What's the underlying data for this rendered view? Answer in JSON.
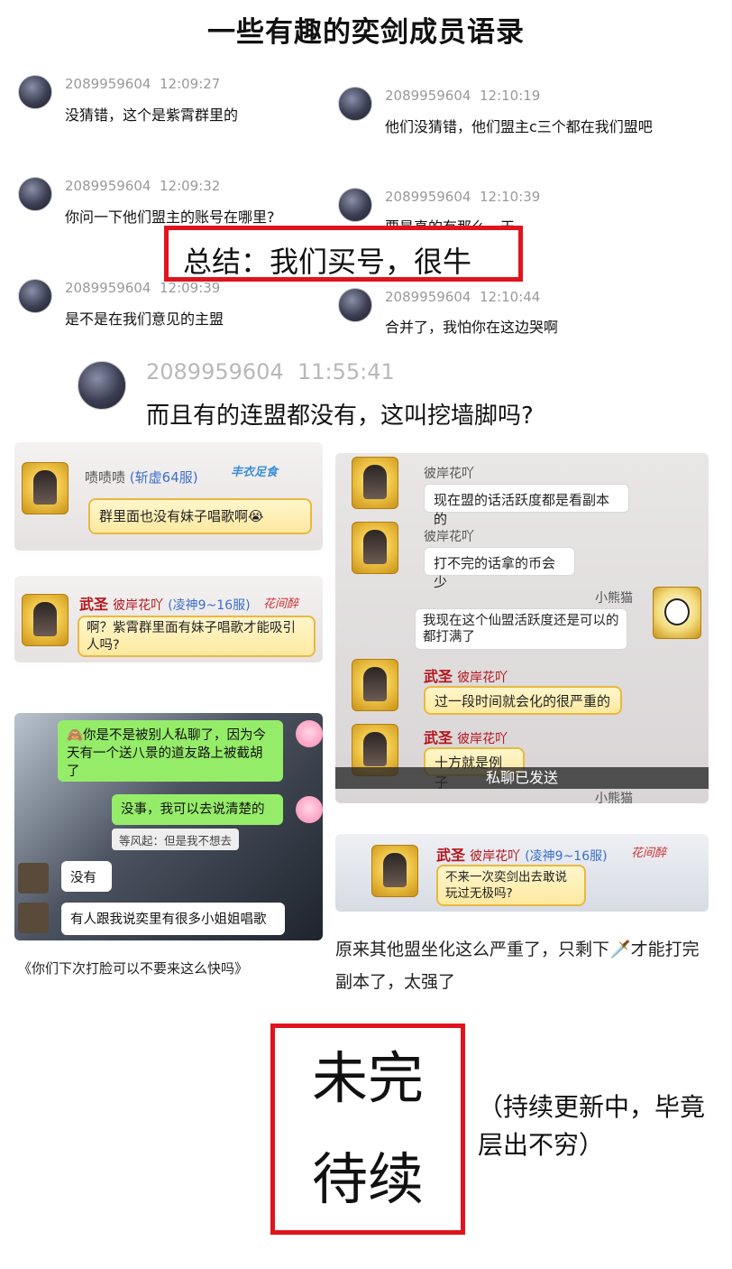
{
  "title": "一些有趣的奕剑成员语录",
  "chat_log": {
    "left": [
      {
        "id": "2089959604",
        "time": "12:09:27",
        "text": "没猜错，这个是紫霄群里的"
      },
      {
        "id": "2089959604",
        "time": "12:09:32",
        "text": "你问一下他们盟主的账号在哪里?"
      },
      {
        "id": "2089959604",
        "time": "12:09:39",
        "text": "是不是在我们意见的主盟"
      }
    ],
    "right": [
      {
        "id": "2089959604",
        "time": "12:10:19",
        "text": "他们没猜错，他们盟主c三个都在我们盟吧"
      },
      {
        "id": "2089959604",
        "time": "12:10:39",
        "text": "要是真的有那么一天"
      },
      {
        "id": "2089959604",
        "time": "12:10:44",
        "text": "合并了，我怕你在这边哭啊"
      }
    ],
    "summary": "总结：我们买号，很牛"
  },
  "big_message": {
    "id": "2089959604",
    "time": "11:55:41",
    "text": "而且有的连盟都没有，这叫挖墙脚吗?"
  },
  "game_left_1": {
    "name": "啧啧啧",
    "server": "(斩虚64服)",
    "badge": "丰衣足食",
    "text": "群里面也没有妹子唱歌啊😭"
  },
  "game_left_2": {
    "rank": "武圣",
    "name": "彼岸花吖",
    "server": "(凌神9~16服)",
    "badge": "花间醉",
    "text": "啊？紫霄群里面有妹子唱歌才能吸引人吗?"
  },
  "wechat": {
    "messages": [
      {
        "side": "right",
        "text": "🙈你是不是被别人私聊了，因为今天有一个送八景的道友路上被截胡了"
      },
      {
        "side": "right",
        "text": "没事，我可以去说清楚的"
      },
      {
        "side": "quote",
        "text": "等风起：但是我不想去"
      },
      {
        "side": "left",
        "text": "没有"
      },
      {
        "side": "left",
        "text": "有人跟我说奕里有很多小姐姐唱歌"
      }
    ],
    "caption": "《你们下次打脸可以不要来这么快吗》"
  },
  "game_right": {
    "messages": [
      {
        "name": "彼岸花吖",
        "text": "现在盟的话活跃度都是看副本的"
      },
      {
        "name": "彼岸花吖",
        "text": "打不完的话拿的币会少"
      },
      {
        "name": "小熊猫",
        "text": "我现在这个仙盟活跃度还是可以的都打满了"
      },
      {
        "rank": "武圣",
        "name": "彼岸花吖",
        "text": "过一段时间就会化的很严重的"
      },
      {
        "rank": "武圣",
        "name": "彼岸花吖",
        "text": "十方就是例子"
      }
    ],
    "overlay": "私聊已发送",
    "footer_name": "小熊猫"
  },
  "game_right_2": {
    "rank": "武圣",
    "name": "彼岸花吖",
    "server": "(凌神9~16服)",
    "badge": "花间醉",
    "text": "不来一次奕剑出去敢说玩过无极吗?"
  },
  "right_caption": "原来其他盟坐化这么严重了，只剩下🗡️才能打完副本了，太强了",
  "footer": {
    "line1": "未完",
    "line2": "待续",
    "note": "（持续更新中，毕竟层出不穷）"
  },
  "colors": {
    "red_box": "#e0141e",
    "wechat_green": "#95ec69",
    "game_gold": "#e9b840",
    "rank_red": "#b3151b"
  }
}
